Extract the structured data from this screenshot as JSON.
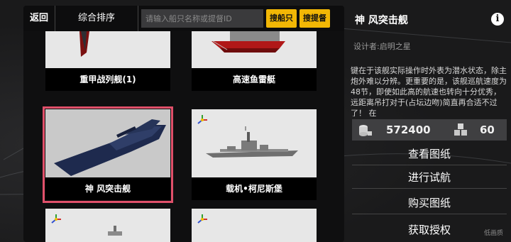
{
  "topbar": {
    "back_label": "返回",
    "sort_label": "综合排序",
    "search_placeholder": "请输入船只名称或提督ID",
    "search_ship_label": "搜船只",
    "search_admiral_label": "搜提督"
  },
  "cards": [
    {
      "title": "重甲战列舰(1)"
    },
    {
      "title": "高速鱼雷艇"
    },
    {
      "title": "神 风突击舰"
    },
    {
      "title": "载机•柯尼斯堡"
    },
    {
      "title": ""
    },
    {
      "title": ""
    }
  ],
  "detail": {
    "name": "神 风突击舰",
    "designer": "设计者:启明之星",
    "description": "键在于该舰实际操作时外表为潜水状态，除主炮外难以分辨。更重要的是，该舰巡航速度为48节，即使如此高的航速也转向十分优秀，远距离吊打对于(占坛边吻)简直再合适不过了！ 在",
    "price": "572400",
    "parts_count": "60",
    "actions": [
      "查看图纸",
      "进行试航",
      "购买图纸",
      "获取授权"
    ],
    "quality_label": "低画质"
  },
  "colors": {
    "accent_yellow": "#f2b705",
    "selected_border": "#e0506a"
  }
}
